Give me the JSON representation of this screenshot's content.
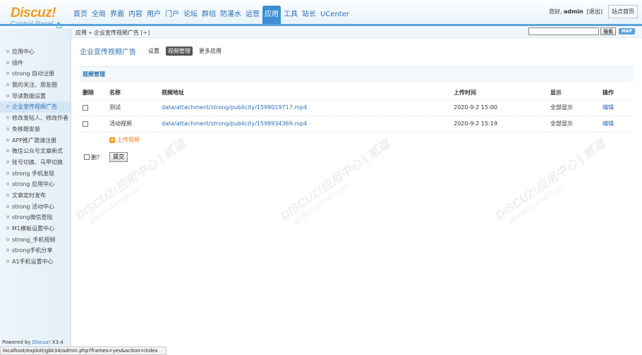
{
  "logo": {
    "main": "Discuz!",
    "sub": "Control Panel"
  },
  "topnav": [
    {
      "label": "首页",
      "active": false
    },
    {
      "label": "全局",
      "active": false
    },
    {
      "label": "界面",
      "active": false
    },
    {
      "label": "内容",
      "active": false
    },
    {
      "label": "用户",
      "active": false
    },
    {
      "label": "门户",
      "active": false
    },
    {
      "label": "论坛",
      "active": false
    },
    {
      "label": "群组",
      "active": false
    },
    {
      "label": "防灌水",
      "active": false
    },
    {
      "label": "运营",
      "active": false
    },
    {
      "label": "应用",
      "active": true
    },
    {
      "label": "工具",
      "active": false
    },
    {
      "label": "站长",
      "active": false
    },
    {
      "label": "UCenter",
      "active": false
    }
  ],
  "user": {
    "greeting": "您好,",
    "name": "admin",
    "logout": "[退出]",
    "site_home": "站点首页"
  },
  "crumb": {
    "text": "应用 » 企业宣传视频广告",
    "plus": "[+]"
  },
  "search": {
    "value": "",
    "button": "搜索",
    "map": "MAP"
  },
  "sidebar": {
    "items": [
      {
        "label": "应用中心",
        "active": false
      },
      {
        "label": "插件",
        "active": false
      },
      {
        "label": "strong 自动注册",
        "active": false
      },
      {
        "label": "我的关注、朋友圈",
        "active": false
      },
      {
        "label": "导读数据设置",
        "active": false
      },
      {
        "label": "企业宣传视频广告",
        "active": true
      },
      {
        "label": "修改发帖人、修改作者",
        "active": false
      },
      {
        "label": "免移题安装",
        "active": false
      },
      {
        "label": "APP推广邀请注册",
        "active": false
      },
      {
        "label": "微信公众号文章新式",
        "active": false
      },
      {
        "label": "账号切换、马甲切换",
        "active": false
      },
      {
        "label": "strong 手机发现",
        "active": false
      },
      {
        "label": "strong 应用中心",
        "active": false
      },
      {
        "label": "文章定时发布",
        "active": false
      },
      {
        "label": "strong 活动中心",
        "active": false
      },
      {
        "label": "strong微信登陆",
        "active": false
      },
      {
        "label": "M1模板设置中心",
        "active": false
      },
      {
        "label": "strong_手机视频",
        "active": false
      },
      {
        "label": "strong手机分享",
        "active": false
      },
      {
        "label": "A1手机设置中心",
        "active": false
      }
    ],
    "powered_prefix": "Powered by ",
    "powered_link": "Discuz!",
    "powered_version": " X3.4"
  },
  "main": {
    "title": "企业宣传视频广告",
    "tabs": [
      {
        "label": "设置",
        "active": false
      },
      {
        "label": "视频管理",
        "active": true
      },
      {
        "label": "更多应用",
        "active": false
      }
    ],
    "section": "视频管理",
    "columns": [
      "删除",
      "名称",
      "视频地址",
      "上传时间",
      "显示",
      "操作"
    ],
    "rows": [
      {
        "name": "测试",
        "url": "data/attachment/strong/publicity/1599019717.mp4",
        "time": "2020-9-2 15:00",
        "display": "全部显示",
        "action": "编辑"
      },
      {
        "name": "活动视频",
        "url": "data/attachment/strong/publicity/1598934369.mp4",
        "time": "2020-9-2 15:19",
        "display": "全部显示",
        "action": "编辑"
      }
    ],
    "add_label": "上传视频",
    "delete_label": "删?",
    "submit": "提交"
  },
  "statusbar": "localhost/exploit/gbk34/admin.php?frames=yes&action=index"
}
